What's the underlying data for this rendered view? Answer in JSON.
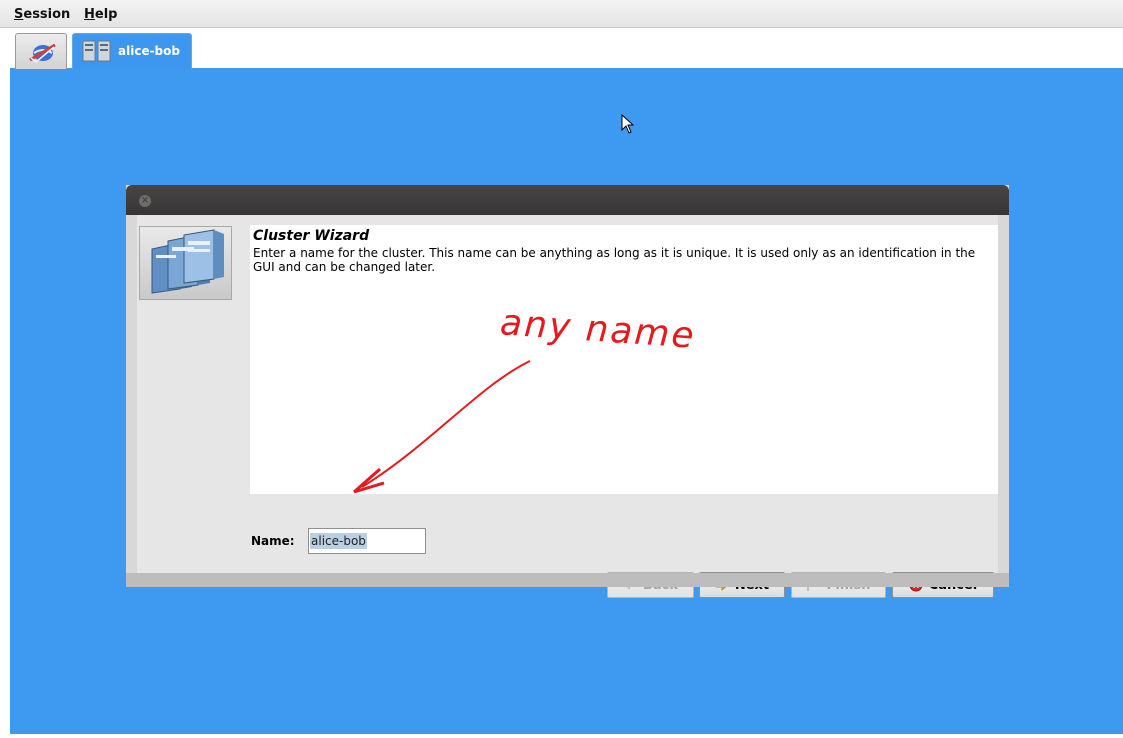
{
  "menubar": {
    "items": [
      {
        "mnemonic": "S",
        "rest": "ession"
      },
      {
        "mnemonic": "H",
        "rest": "elp"
      }
    ]
  },
  "tabs": [
    {
      "label": "",
      "icon": "home-globe-icon"
    },
    {
      "label": "alice-bob",
      "icon": "cluster-servers-icon"
    }
  ],
  "dialog": {
    "title": "Cluster Wizard",
    "description": "Enter a name for the cluster. This name can be anything as long as it is unique. It is used only as an identification in the GUI and can be changed later.",
    "annotation": "any name",
    "name_label": "Name:",
    "name_value": "alice-bob",
    "buttons": {
      "back": "Back",
      "next": "Next",
      "finish": "Finish",
      "cancel": "Cancel"
    }
  },
  "colors": {
    "workspace": "#3e9af1",
    "annotation": "#e8191d",
    "dialog_titlebar": "#3f3d3d"
  }
}
